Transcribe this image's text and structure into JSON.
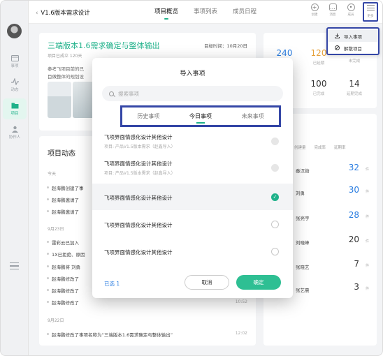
{
  "window": {
    "light_colors": [
      "#ff5f57",
      "#febc2e",
      "#28c840"
    ]
  },
  "rail": {
    "items": [
      {
        "label": "事项",
        "icon": "calendar-icon"
      },
      {
        "label": "动态",
        "icon": "activity-icon"
      },
      {
        "label": "项目",
        "icon": "folder-icon"
      },
      {
        "label": "协作人",
        "icon": "people-icon"
      }
    ]
  },
  "topbar": {
    "back_label": "V1.6版本需求设计",
    "tabs": [
      "项目概览",
      "事项列表",
      "成员日程"
    ],
    "active_tab": "项目概览",
    "tools": [
      {
        "label": "创建",
        "icon": "plus-circle-icon"
      },
      {
        "label": "消息",
        "icon": "chat-icon"
      },
      {
        "label": "成员",
        "icon": "people-icon"
      },
      {
        "label": "更多",
        "icon": "menu-icon"
      }
    ]
  },
  "dropdown": {
    "items": [
      {
        "label": "导入事项",
        "icon": "import-icon"
      },
      {
        "label": "解散项目",
        "icon": "dissolve-icon"
      }
    ]
  },
  "project": {
    "title": "三端版本1.6需求确定与整体输出",
    "target_date": "目标时间：10月20日",
    "sub": "项目已成立 120天",
    "desc_line1": "参考飞项目前的已",
    "desc_line2": "目做整体的规划设"
  },
  "stats": [
    {
      "num": "240",
      "label": "",
      "color": "#2a7de1"
    },
    {
      "num": "120",
      "label": "已延期",
      "color": "#e6a23c"
    },
    {
      "num": "",
      "label": "未完成",
      "color": "#333"
    },
    {
      "num": "100",
      "label": "已完成",
      "color": "#333"
    },
    {
      "num": "14",
      "label": "延期完成",
      "color": "#333"
    }
  ],
  "feed": {
    "title": "项目动态",
    "groups": [
      {
        "day": "今天",
        "rows": [
          "赵海鹏创建了事",
          "赵海鹏邀请了 ",
          "赵海鹏邀请了 "
        ]
      },
      {
        "day": "9月23日",
        "rows": [
          "雷彩云已加入",
          "1X已拒绝、原因",
          "赵海鹏将 刘勇",
          "赵海鹏修改了",
          "赵海鹏修改了",
          "赵海鹏修改了",
          "赵海鹏修改了事项背景信息"
        ]
      },
      {
        "day": "9月22日",
        "rows": [
          "赵海鹏修改了事项名称为“三端版本1.6需求确定与整体输出”"
        ]
      }
    ],
    "times": [
      "10:52",
      "12:02"
    ]
  },
  "members": {
    "columns": [
      "创建量",
      "完成率",
      "延期率"
    ],
    "rows": [
      {
        "name": "秦汉街",
        "value": "32",
        "unit": "件",
        "highlight": true
      },
      {
        "name": "刘勇",
        "value": "30",
        "unit": "件",
        "highlight": true
      },
      {
        "name": "张亮宇",
        "value": "28",
        "unit": "件",
        "highlight": true
      },
      {
        "name": "刘晓峰",
        "value": "20",
        "unit": "件",
        "highlight": false
      },
      {
        "name": "张晓艺",
        "value": "7",
        "unit": "件",
        "highlight": false
      },
      {
        "name": "张艺晨",
        "value": "3",
        "unit": "件",
        "highlight": false
      }
    ]
  },
  "modal": {
    "title": "导入事项",
    "search_placeholder": "搜索事项",
    "tabs": [
      "历史事项",
      "今日事项",
      "未来事项"
    ],
    "active_tab": "今日事项",
    "items": [
      {
        "title": "飞项界面情感化设计其他设计",
        "sub": "项目: 产品V1.5版本需求（赵鑫导入）",
        "state": "disabled"
      },
      {
        "title": "飞项界面情感化设计其他设计",
        "sub": "项目: 产品V1.5版本需求（赵鑫导入）",
        "state": "disabled"
      },
      {
        "title": "飞项界面情感化设计其他设计",
        "sub": "",
        "state": "checked"
      },
      {
        "title": "飞项界面情感化设计其他设计",
        "sub": "",
        "state": "empty"
      },
      {
        "title": "飞项界面情感化设计其他设计",
        "sub": "",
        "state": "empty"
      }
    ],
    "selected_label": "已选",
    "selected_count": "1",
    "cancel_label": "取消",
    "ok_label": "确定"
  },
  "colors": {
    "accent": "#1fb18a",
    "highlight_box": "#3446a6",
    "link": "#2a7de1"
  }
}
